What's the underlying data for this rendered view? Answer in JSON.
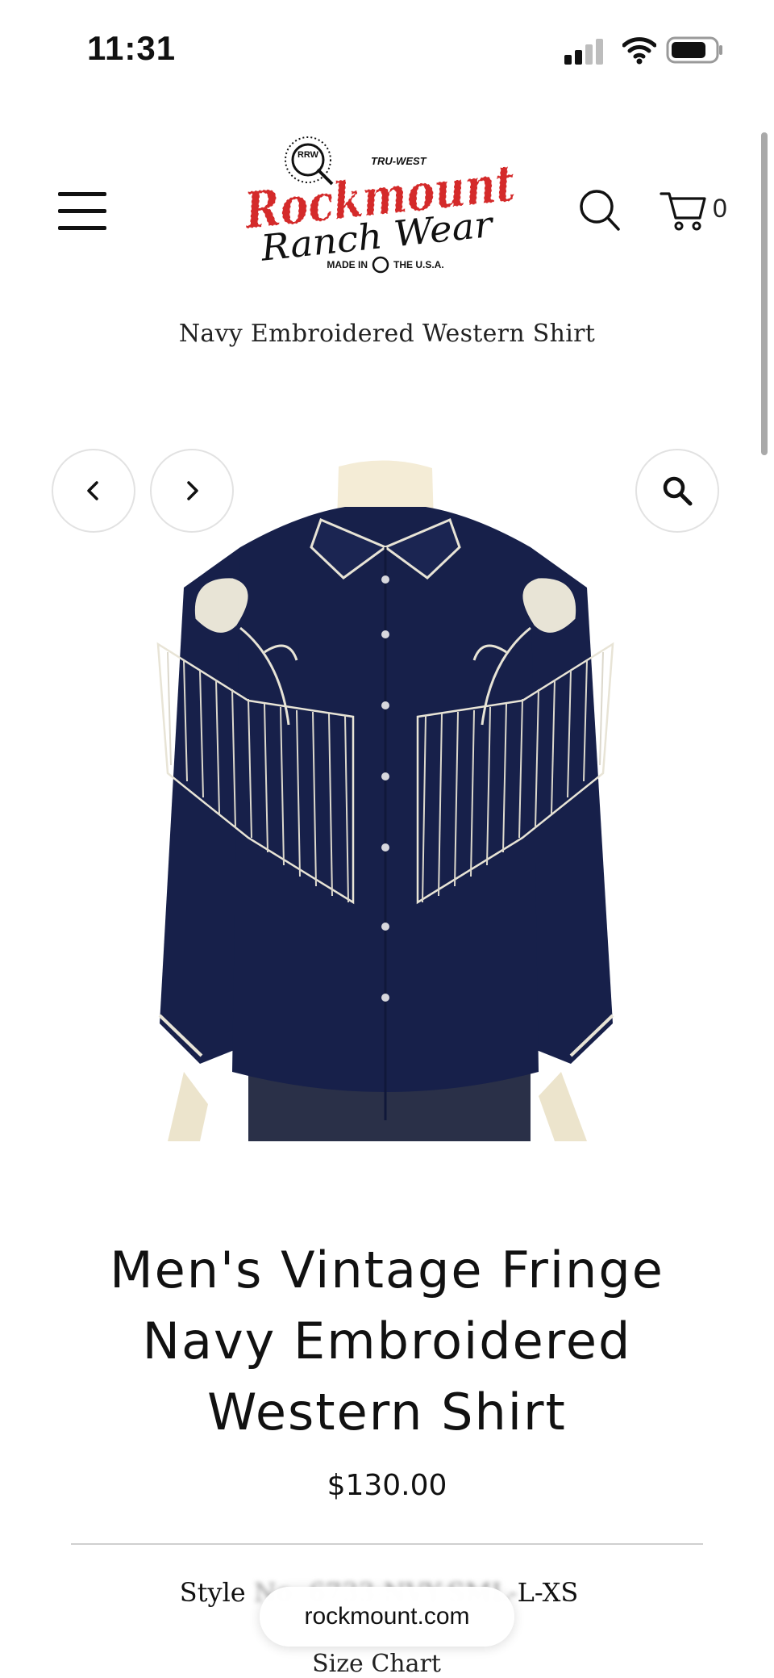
{
  "status_bar": {
    "time": "11:31",
    "icons": [
      "signal-icon",
      "wifi-icon",
      "battery-icon"
    ]
  },
  "header": {
    "logo": {
      "top_text": "TRU-WEST",
      "brand_line1": "Rockmount",
      "brand_line2": "Ranch Wear",
      "made_in": "MADE IN",
      "the_usa": "THE U.S.A.",
      "monogram": "RRW"
    },
    "icons": [
      "menu-icon",
      "search-icon",
      "cart-icon"
    ],
    "cart_count": "0"
  },
  "breadcrumb": "Navy Embroidered Western Shirt",
  "gallery": {
    "icons": [
      "chevron-left-icon",
      "chevron-right-icon",
      "zoom-icon"
    ]
  },
  "product": {
    "title_lines": [
      "Men's Vintage Fringe",
      "Navy Embroidered",
      "Western Shirt"
    ],
    "price": "$130.00",
    "style_label": "Style",
    "style_hidden": "No: 6733-NVY-SML-",
    "style_end": "L-XS",
    "size_chart": "Size Chart"
  },
  "browser": {
    "url": "rockmount.com"
  },
  "colors": {
    "brand_red": "#d42a2a",
    "shirt_navy": "#17204a",
    "text": "#111111"
  }
}
